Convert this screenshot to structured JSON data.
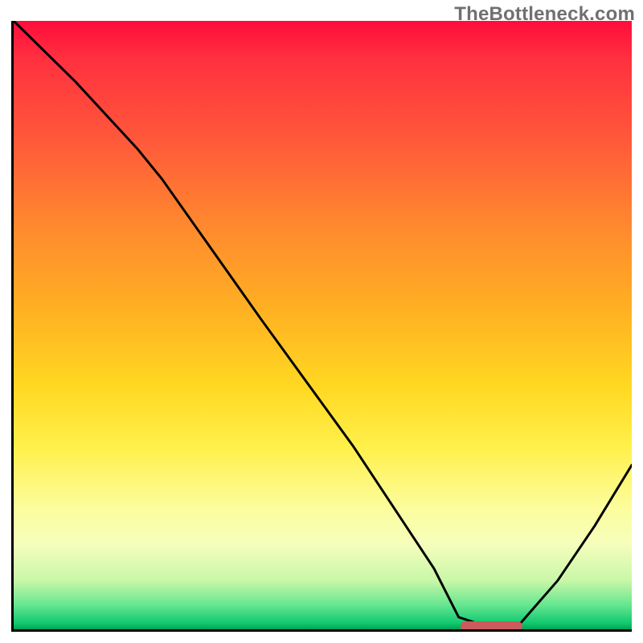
{
  "watermark": "TheBottleneck.com",
  "colors": {
    "axis": "#000000",
    "curve": "#000000",
    "marker": "#cc5a5a",
    "gradient_stops": [
      "#ff0d3a",
      "#ff2f3f",
      "#ff5a3a",
      "#ff8a2e",
      "#ffb222",
      "#ffd822",
      "#fff04a",
      "#fcfd9c",
      "#f6febc",
      "#c8f7a8",
      "#66e690",
      "#10c970",
      "#00a055"
    ]
  },
  "chart_data": {
    "type": "line",
    "title": "",
    "xlabel": "",
    "ylabel": "",
    "xlim": [
      0,
      100
    ],
    "ylim": [
      0,
      100
    ],
    "annotations": [
      {
        "text_key": "watermark",
        "x": 98,
        "y": 102,
        "anchor": "top-right"
      }
    ],
    "marker": {
      "x_start": 72,
      "x_end": 82,
      "y": 0
    },
    "series": [
      {
        "name": "bottleneck-curve",
        "x": [
          0,
          10,
          20,
          24,
          40,
          55,
          68,
          72,
          78,
          82,
          88,
          94,
          100
        ],
        "y": [
          100,
          90,
          79,
          74,
          51,
          30,
          10,
          2,
          0,
          1,
          8,
          17,
          27
        ]
      }
    ],
    "note": "x and y are in percent of the inner plot area; y=0 is the bottom axis, y=100 is the top edge."
  }
}
